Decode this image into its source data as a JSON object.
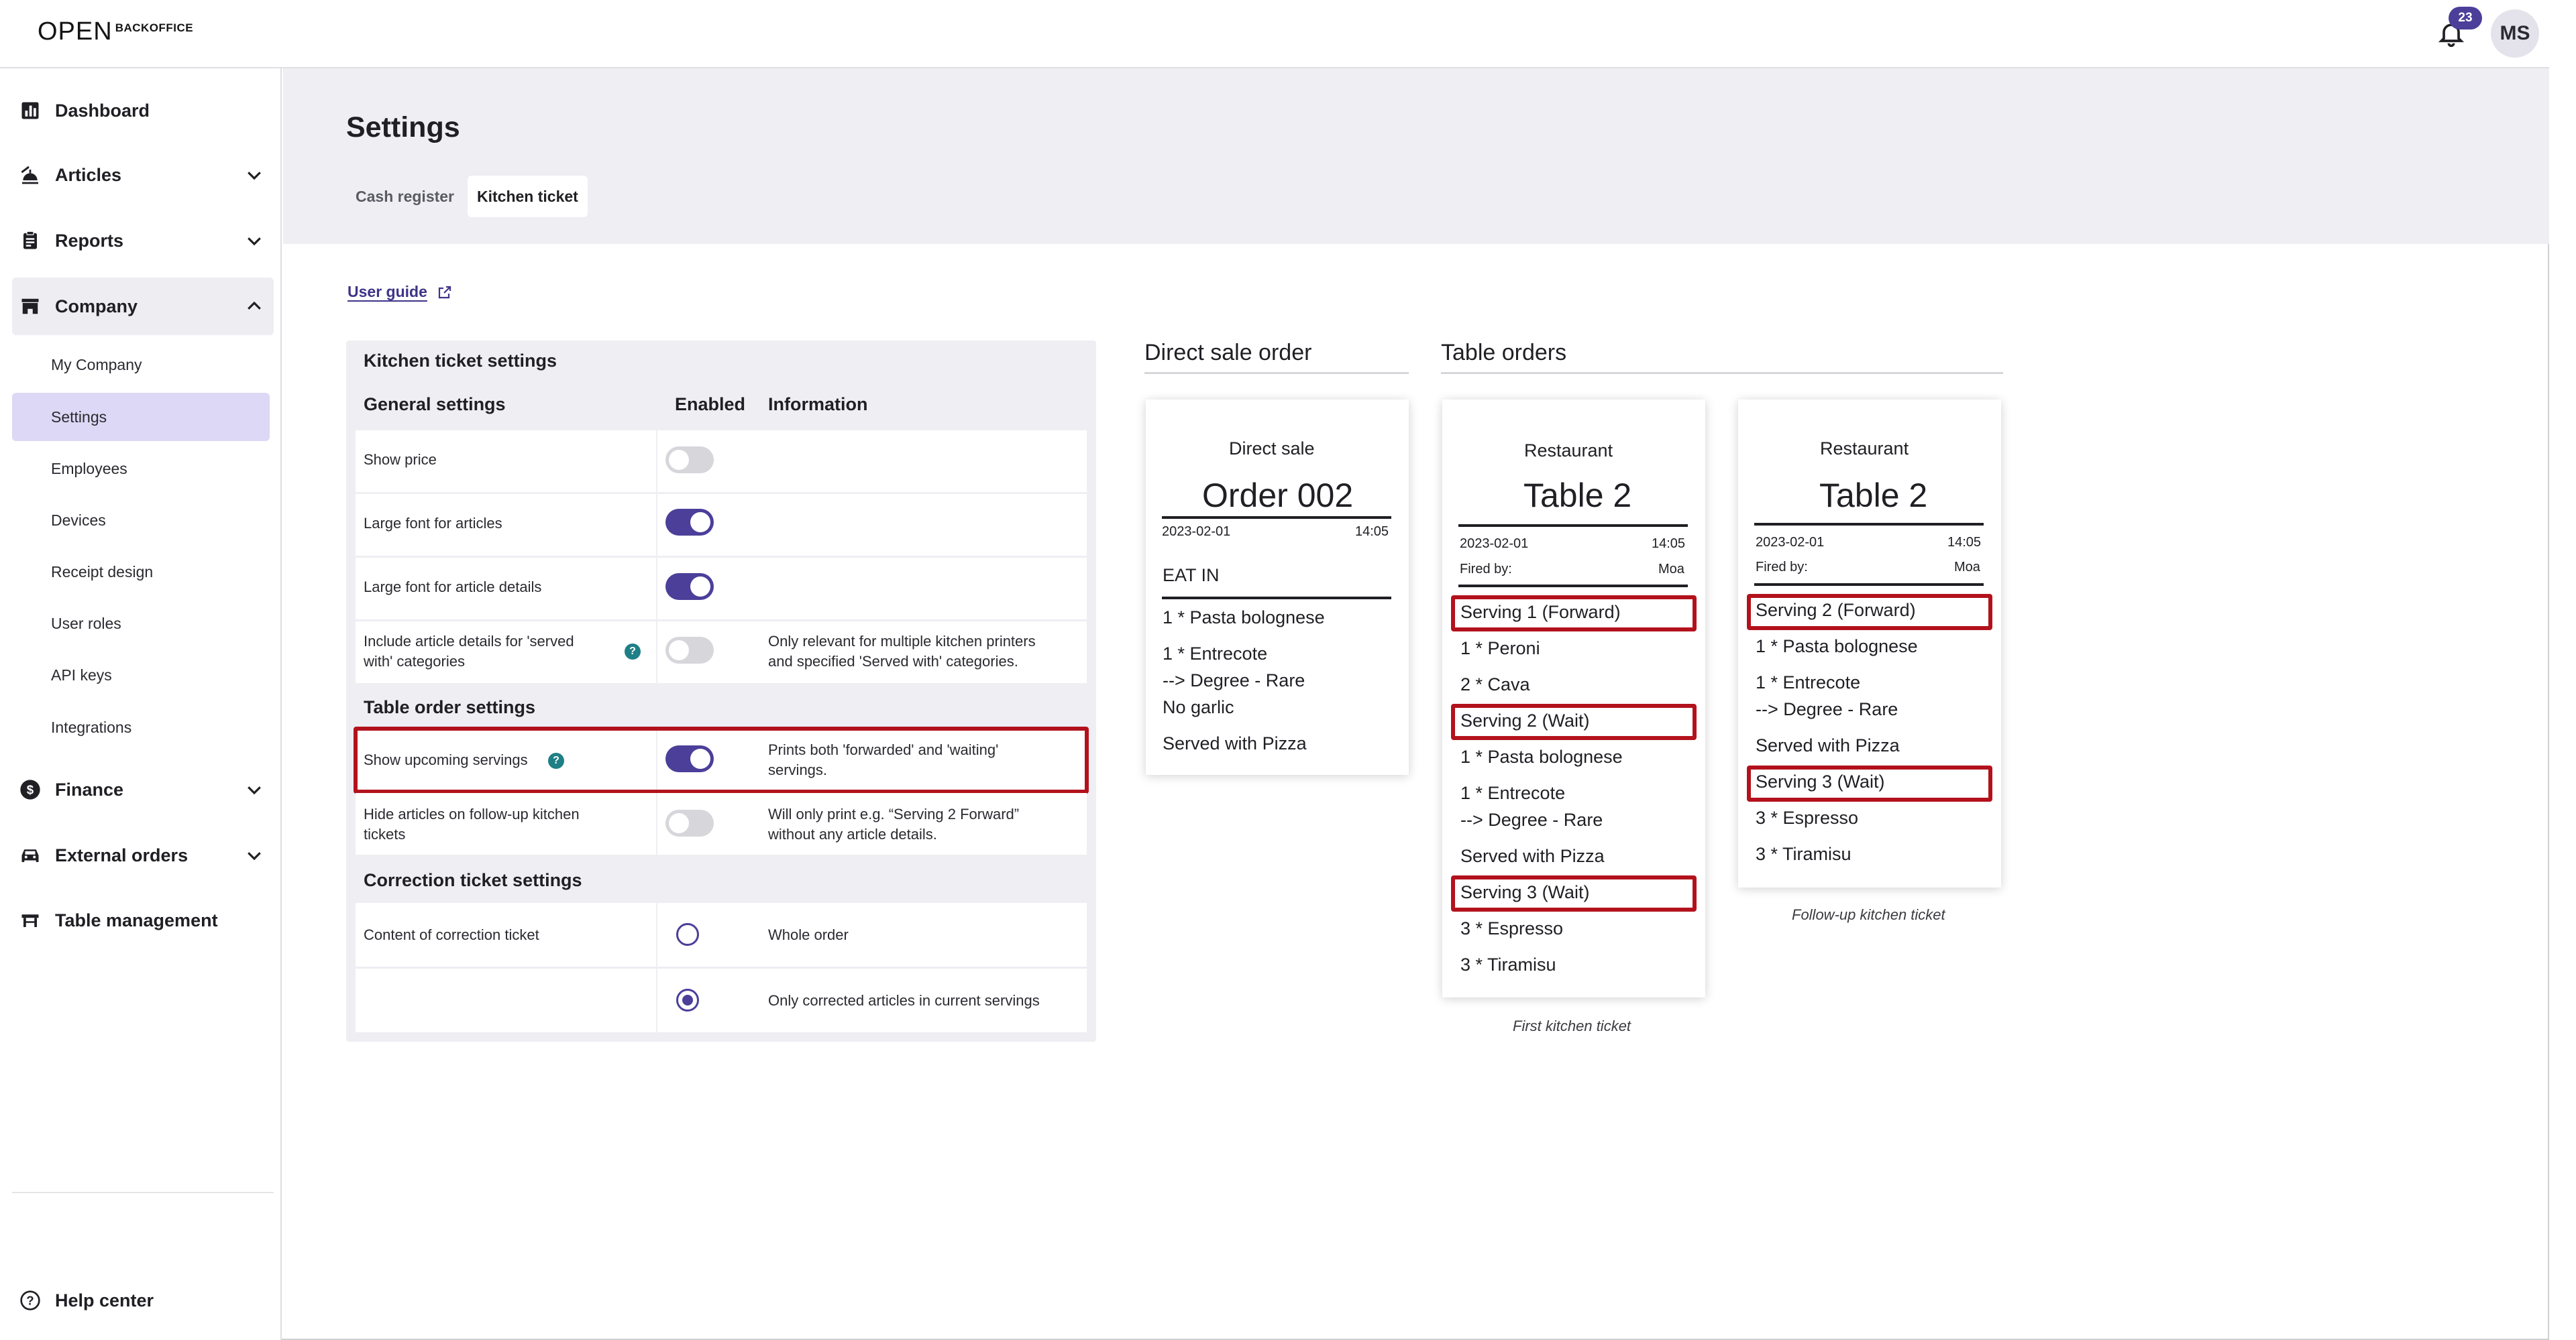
{
  "brand": {
    "logo_mark": "OPEN",
    "logo_sub": "BACKOFFICE"
  },
  "topbar": {
    "notifications_count": "23",
    "avatar_initials": "MS"
  },
  "sidebar": {
    "items": [
      {
        "label": "Dashboard",
        "icon": "bar-chart-icon"
      },
      {
        "label": "Articles",
        "icon": "food-icon"
      },
      {
        "label": "Reports",
        "icon": "clipboard-icon"
      },
      {
        "label": "Company",
        "icon": "store-icon"
      },
      {
        "label": "Finance",
        "icon": "dollar-icon"
      },
      {
        "label": "External orders",
        "icon": "car-icon"
      },
      {
        "label": "Table management",
        "icon": "table-icon"
      }
    ],
    "company_sub": [
      {
        "label": "My Company"
      },
      {
        "label": "Settings"
      },
      {
        "label": "Employees"
      },
      {
        "label": "Devices"
      },
      {
        "label": "Receipt design"
      },
      {
        "label": "User roles"
      },
      {
        "label": "API keys"
      },
      {
        "label": "Integrations"
      }
    ],
    "help_center": "Help center"
  },
  "page": {
    "title": "Settings",
    "tabs": [
      {
        "label": "Cash register"
      },
      {
        "label": "Kitchen ticket"
      }
    ],
    "user_guide": "User guide"
  },
  "settings_table": {
    "title": "Kitchen ticket settings",
    "columns": {
      "setting": "General settings",
      "enabled": "Enabled",
      "info": "Information"
    },
    "general": [
      {
        "label": "Show price",
        "enabled": false,
        "info": ""
      },
      {
        "label": "Large font for articles",
        "enabled": true,
        "info": ""
      },
      {
        "label": "Large font for article details",
        "enabled": true,
        "info": ""
      },
      {
        "label_line1": "Include article details for 'served",
        "label_line2": "with' categories",
        "enabled": false,
        "info_line1": "Only relevant for multiple kitchen printers",
        "info_line2": "and specified 'Served with' categories."
      }
    ],
    "table_order_heading": "Table order settings",
    "table_order": [
      {
        "label": "Show upcoming servings",
        "enabled": true,
        "info_line1": "Prints both 'forwarded' and 'waiting'",
        "info_line2": "servings."
      },
      {
        "label_line1": "Hide articles on follow-up kitchen",
        "label_line2": "tickets",
        "enabled": false,
        "info_line1": "Will only print e.g. “Serving 2 Forward”",
        "info_line2": "without any article details."
      }
    ],
    "correction_heading": "Correction ticket settings",
    "correction": {
      "label": "Content of correction ticket",
      "options": [
        {
          "label": "Whole order",
          "selected": false
        },
        {
          "label": "Only corrected articles in current servings",
          "selected": true
        }
      ]
    }
  },
  "preview": {
    "direct_heading": "Direct sale order",
    "table_heading": "Table orders",
    "direct_ticket": {
      "subtitle": "Direct sale",
      "title": "Order 002",
      "date": "2023-02-01",
      "time": "14:05",
      "mode": "EAT IN",
      "lines": [
        "1 * Pasta bolognese",
        "1 * Entrecote",
        "--> Degree - Rare",
        "No garlic",
        "Served with Pizza"
      ]
    },
    "first_ticket": {
      "subtitle": "Restaurant",
      "title": "Table 2",
      "date": "2023-02-01",
      "time": "14:05",
      "fired_by_label": "Fired by:",
      "fired_by": "Moa",
      "lines": [
        "Serving 1 (Forward)",
        "1 * Peroni",
        "2 * Cava",
        "Serving 2 (Wait)",
        "1 * Pasta bolognese",
        "1 * Entrecote",
        "--> Degree - Rare",
        "Served with Pizza",
        "Serving 3 (Wait)",
        "3 * Espresso",
        "3 * Tiramisu"
      ],
      "caption": "First kitchen ticket"
    },
    "followup_ticket": {
      "subtitle": "Restaurant",
      "title": "Table 2",
      "date": "2023-02-01",
      "time": "14:05",
      "fired_by_label": "Fired by:",
      "fired_by": "Moa",
      "lines": [
        "Serving 2 (Forward)",
        "1 * Pasta bolognese",
        "1 * Entrecote",
        "--> Degree - Rare",
        "Served with Pizza",
        "Serving 3 (Wait)",
        "3 * Espresso",
        "3 * Tiramisu"
      ],
      "caption": "Follow-up kitchen ticket"
    }
  },
  "colors": {
    "accent": "#4b3f9a",
    "highlight": "#b3121c",
    "active_nav": "#ddd8f5",
    "header_bg": "#eeeef3"
  }
}
